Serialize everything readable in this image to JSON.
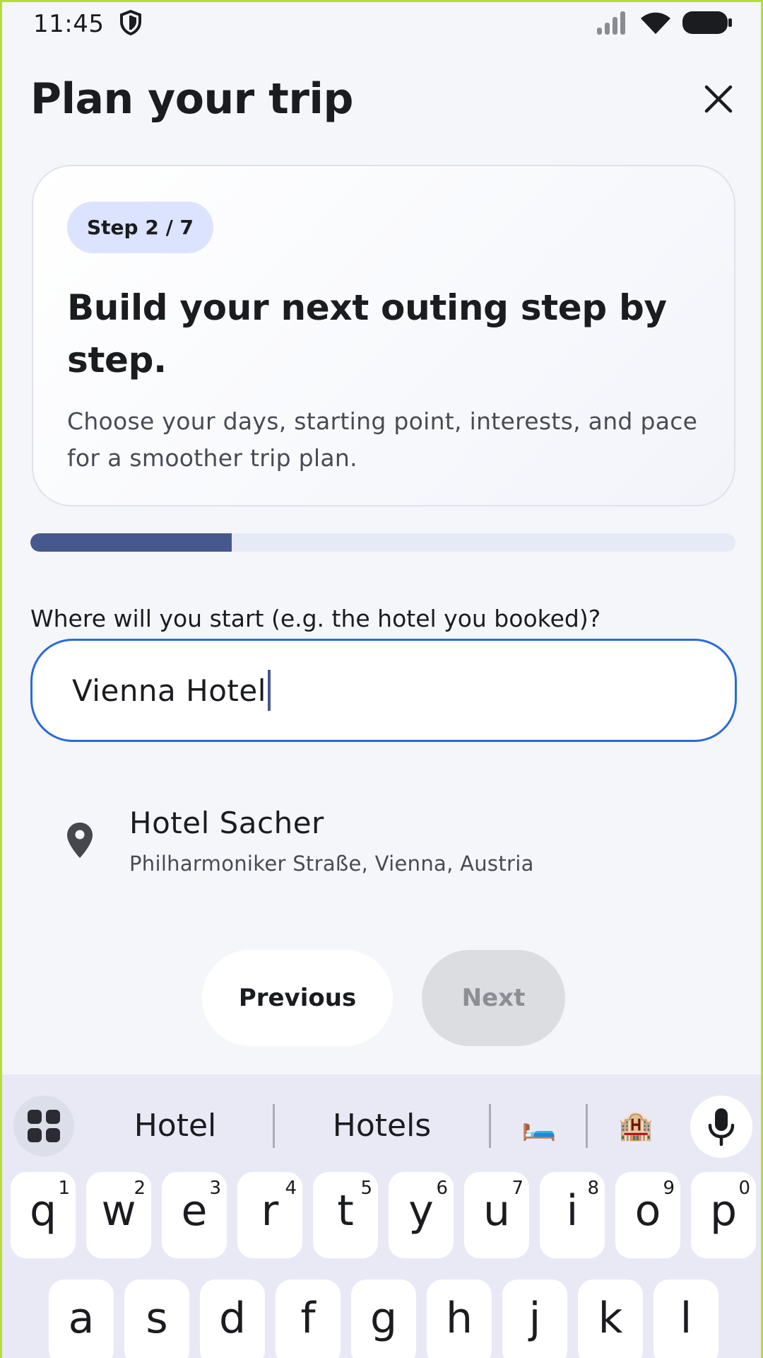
{
  "status_bar": {
    "time": "11:45",
    "icons": [
      "shield-icon",
      "signal-icon",
      "wifi-icon",
      "battery-icon"
    ]
  },
  "header": {
    "title": "Plan your trip",
    "close_icon": "close-icon"
  },
  "intro": {
    "step_badge": "Step 2 / 7",
    "heading": "Build your next outing step by step.",
    "description": "Choose your days, starting point, interests, and pace for a smoother trip plan."
  },
  "progress": {
    "fraction": 0.2857,
    "fill_color": "#47588e",
    "track_color": "#e5eaf6"
  },
  "start_field": {
    "label": "Where will you start (e.g. the hotel you booked)?",
    "value": "Vienna Hotel",
    "focused": true,
    "border_color": "#2a6ad8"
  },
  "suggestions": [
    {
      "icon": "location-pin-icon",
      "title": "Hotel Sacher",
      "subtitle": "Philharmoniker Straße, Vienna, Austria"
    }
  ],
  "navigation": {
    "previous_label": "Previous",
    "next_label": "Next",
    "next_enabled": false
  },
  "keyboard": {
    "menu_icon": "keyboard-apps-icon",
    "word_suggestions": [
      "Hotel",
      "Hotels"
    ],
    "emoji_suggestions": [
      "🛏️",
      "🏨"
    ],
    "mic_icon": "microphone-icon",
    "row1": [
      {
        "key": "q",
        "hint": "1"
      },
      {
        "key": "w",
        "hint": "2"
      },
      {
        "key": "e",
        "hint": "3"
      },
      {
        "key": "r",
        "hint": "4"
      },
      {
        "key": "t",
        "hint": "5"
      },
      {
        "key": "y",
        "hint": "6"
      },
      {
        "key": "u",
        "hint": "7"
      },
      {
        "key": "i",
        "hint": "8"
      },
      {
        "key": "o",
        "hint": "9"
      },
      {
        "key": "p",
        "hint": "0"
      }
    ],
    "row2": [
      "a",
      "s",
      "d",
      "f",
      "g",
      "h",
      "j",
      "k",
      "l"
    ]
  }
}
